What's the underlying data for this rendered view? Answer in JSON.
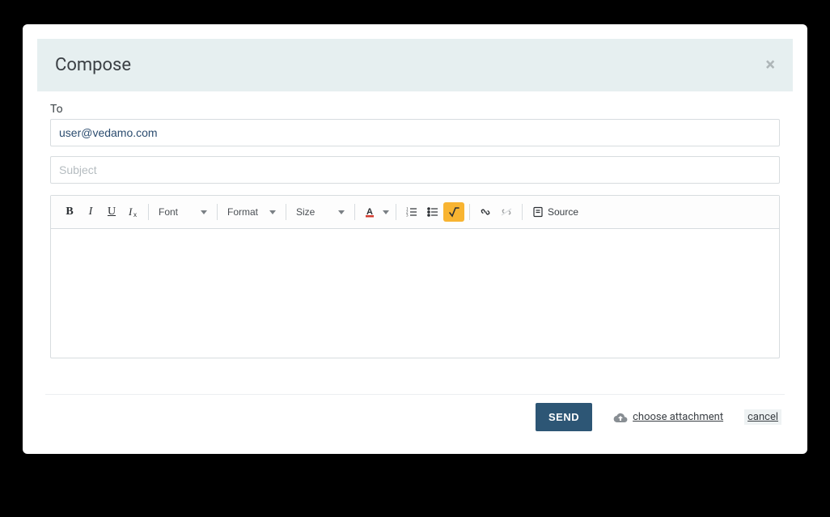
{
  "header": {
    "title": "Compose",
    "close_icon": "close-icon"
  },
  "fields": {
    "to_label": "To",
    "to_value": "user@vedamo.com",
    "subject_placeholder": "Subject",
    "subject_value": ""
  },
  "toolbar": {
    "font_label": "Font",
    "format_label": "Format",
    "size_label": "Size",
    "source_label": "Source"
  },
  "editor": {
    "body_value": ""
  },
  "footer": {
    "send_label": "SEND",
    "attach_label": "choose attachment",
    "cancel_label": "cancel"
  },
  "colors": {
    "accent": "#2d5675",
    "header_bg": "#e6eff0",
    "math_btn_bg": "#f8b431"
  }
}
